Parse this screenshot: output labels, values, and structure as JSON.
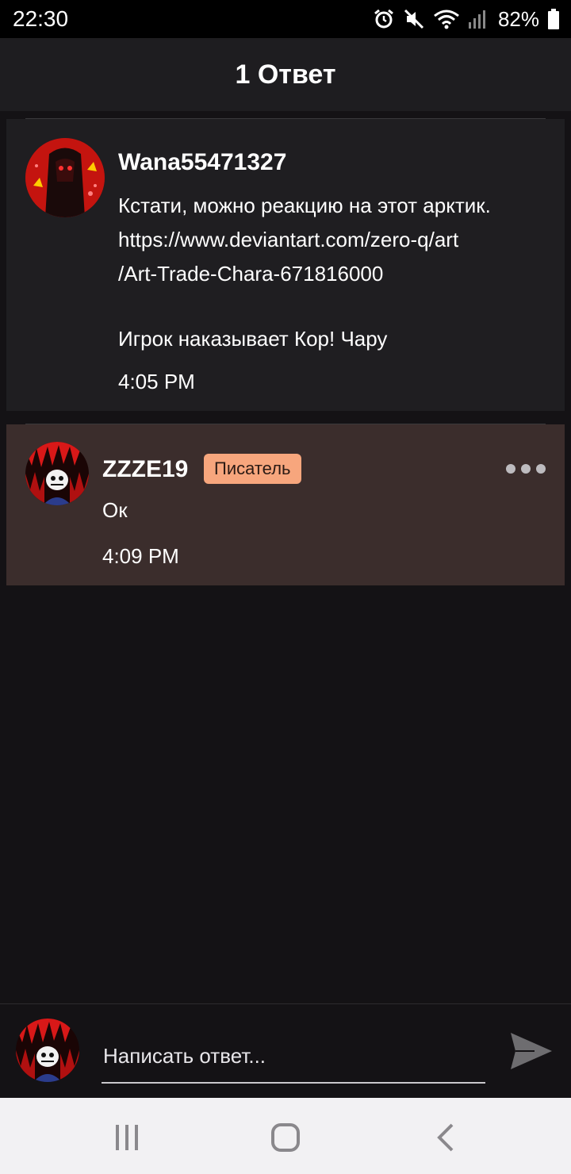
{
  "status_bar": {
    "time": "22:30",
    "battery_percent": "82%",
    "icons": [
      "alarm-icon",
      "mute-icon",
      "wifi-icon",
      "signal-icon",
      "battery-icon"
    ]
  },
  "header": {
    "title": "1 Ответ"
  },
  "comment": {
    "username": "Wana55471327",
    "text_lines": [
      "Кстати, можно реакцию на этот арктик.",
      " https://www.deviantart.com/zero-q/art",
      "/Art-Trade-Chara-671816000",
      "",
      "Игрок наказывает Кор! Чару"
    ],
    "time": "4:05 PM"
  },
  "reply": {
    "username": "ZZZE19",
    "badge": "Писатель",
    "text": "Ок",
    "time": "4:09 PM"
  },
  "compose": {
    "placeholder": "Написать ответ..."
  },
  "colors": {
    "background": "#141215",
    "card": "#1f1e21",
    "reply_card": "#3b2d2c",
    "badge": "#f7a67d",
    "nav_bar": "#f2f1f3"
  }
}
